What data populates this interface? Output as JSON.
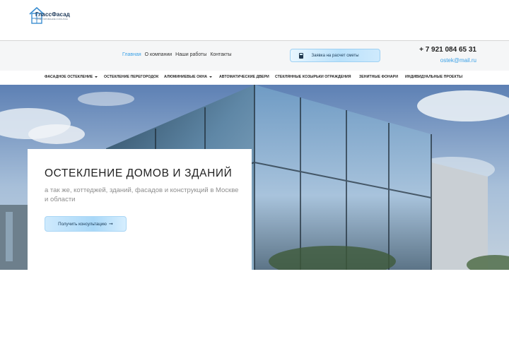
{
  "header": {
    "logo_text": "ГлассФасад",
    "logo_sub": "ПРОЕКТИРОВАНИЕ И МОНТАЖ",
    "nav": [
      {
        "label": "Главная",
        "active": true
      },
      {
        "label": "О компании",
        "active": false
      },
      {
        "label": "Наши работы",
        "active": false
      },
      {
        "label": "Контакты",
        "active": false
      }
    ],
    "estimate_button": "Заявка на расчет сметы",
    "phone": "+ 7 921 084 65 31",
    "email": "ostek@mail.ru"
  },
  "mainnav": {
    "items": [
      {
        "label": "ФАСАДНОЕ ОСТЕКЛЕНИЕ",
        "has_dropdown": true
      },
      {
        "label": "ОСТЕКЛЕНИЕ ПЕРЕГОРОДОК",
        "has_dropdown": false
      },
      {
        "label": "АЛЮМИНИЕВЫЕ ОКНА",
        "has_dropdown": true
      },
      {
        "label": "АВТОМАТИЧЕСКИЕ ДВЕРИ",
        "has_dropdown": false
      },
      {
        "label": "СТЕКЛЯННЫЕ КОЗЫРЬКИ ОГРАЖДЕНИЯ",
        "has_dropdown": false
      },
      {
        "label": "ЗЕНИТНЫЕ ФОНАРИ",
        "has_dropdown": false
      },
      {
        "label": "ИНДИВИДУАЛЬНЫЕ ПРОЕКТЫ",
        "has_dropdown": false
      }
    ]
  },
  "hero": {
    "title": "ОСТЕКЛЕНИЕ ДОМОВ И ЗДАНИЙ",
    "subtitle": "а так же, коттеджей, зданий, фасадов и конструкций в Москве и области",
    "cta": "Получить консультацию"
  },
  "colors": {
    "accent": "#3aa0e6",
    "button_light": "#b9e1fb",
    "text_dark": "#222222",
    "text_muted": "#8e8e8e"
  }
}
